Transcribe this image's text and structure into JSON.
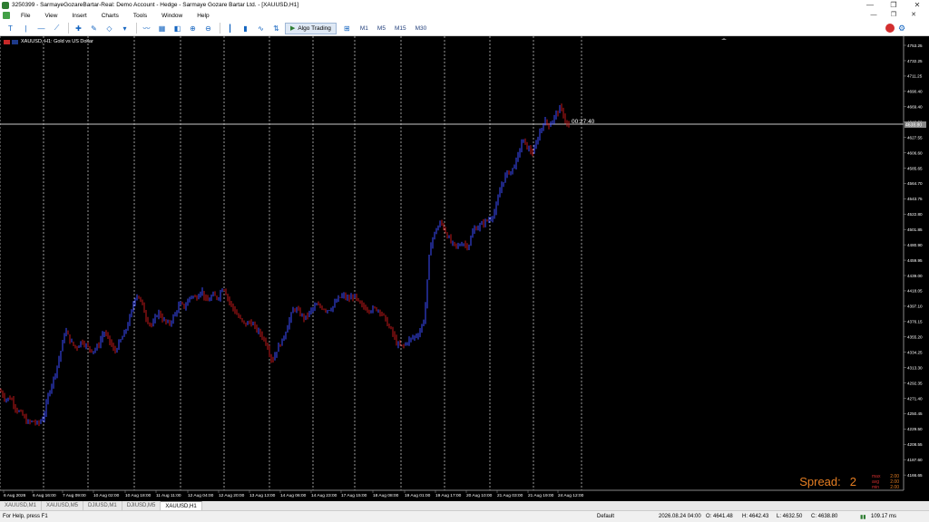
{
  "window": {
    "title": "3250399 - SarmayeGozareBartar-Real: Demo Account - Hedge - Sarmaye Gozare Bartar Ltd. - [XAUUSD,H1]",
    "minimize": "—",
    "maximize": "❐",
    "close": "✕"
  },
  "menu": {
    "items": [
      "File",
      "View",
      "Insert",
      "Charts",
      "Tools",
      "Window",
      "Help"
    ],
    "child_minimize": "—",
    "child_restore": "❐",
    "child_close": "✕"
  },
  "toolbar": {
    "algo_label": "Algo Trading",
    "timeframes": [
      "M1",
      "M5",
      "M15",
      "M30"
    ]
  },
  "chart": {
    "symbol_label": "XAUUSD, H1:  Gold vs US Dollar",
    "countdown": "00:27:40",
    "current_price_label": "4638.80",
    "spread_label": "Spread:",
    "spread_value": "2",
    "stats": [
      {
        "key": "max",
        "value": "2.00"
      },
      {
        "key": "avg",
        "value": "2.00"
      },
      {
        "key": "min",
        "value": "2.00"
      }
    ],
    "colors": {
      "background": "#000000",
      "bull": "#3d4dff",
      "bear": "#c0181a",
      "grid": "#ffffff",
      "axis_text": "#ffffff",
      "price_line": "#c8c8c8",
      "spread_text": "#e67e22"
    }
  },
  "chart_data": {
    "type": "candlestick",
    "title": "XAUUSD, H1: Gold vs US Dollar",
    "ylim": [
      4145.8,
      4765.6
    ],
    "y_ticks": [
      "4753.25",
      "4732.25",
      "4711.25",
      "4690.40",
      "4669.40",
      "4648.50",
      "4627.55",
      "4606.60",
      "4585.65",
      "4564.70",
      "4543.75",
      "4522.80",
      "4501.85",
      "4480.90",
      "4459.95",
      "4439.00",
      "4418.05",
      "4397.10",
      "4376.15",
      "4355.20",
      "4334.25",
      "4313.30",
      "4292.35",
      "4271.40",
      "4250.45",
      "4229.50",
      "4208.55",
      "4187.60",
      "4166.65"
    ],
    "x_ticks": [
      "6 Aug 2026",
      "6 Aug 16:00",
      "7 Aug 09:00",
      "10 Aug 02:00",
      "10 Aug 18:00",
      "11 Aug 11:00",
      "12 Aug 04:00",
      "12 Aug 20:00",
      "13 Aug 13:00",
      "14 Aug 06:00",
      "14 Aug 23:00",
      "17 Aug 15:00",
      "18 Aug 08:00",
      "19 Aug 01:00",
      "19 Aug 17:00",
      "20 Aug 10:00",
      "21 Aug 03:00",
      "21 Aug 19:00",
      "24 Aug 12:00"
    ],
    "close_path": [
      [
        0,
        4282
      ],
      [
        6,
        4270
      ],
      [
        12,
        4272
      ],
      [
        18,
        4256
      ],
      [
        24,
        4250
      ],
      [
        30,
        4238
      ],
      [
        36,
        4240
      ],
      [
        42,
        4236
      ],
      [
        48,
        4246
      ],
      [
        54,
        4280
      ],
      [
        60,
        4302
      ],
      [
        66,
        4330
      ],
      [
        72,
        4365
      ],
      [
        78,
        4348
      ],
      [
        84,
        4340
      ],
      [
        90,
        4350
      ],
      [
        96,
        4342
      ],
      [
        102,
        4336
      ],
      [
        108,
        4342
      ],
      [
        114,
        4362
      ],
      [
        120,
        4352
      ],
      [
        126,
        4334
      ],
      [
        132,
        4348
      ],
      [
        138,
        4362
      ],
      [
        144,
        4385
      ],
      [
        150,
        4415
      ],
      [
        156,
        4402
      ],
      [
        162,
        4378
      ],
      [
        168,
        4370
      ],
      [
        174,
        4390
      ],
      [
        180,
        4378
      ],
      [
        186,
        4372
      ],
      [
        192,
        4384
      ],
      [
        198,
        4400
      ],
      [
        204,
        4396
      ],
      [
        210,
        4412
      ],
      [
        216,
        4408
      ],
      [
        222,
        4420
      ],
      [
        228,
        4402
      ],
      [
        234,
        4412
      ],
      [
        240,
        4408
      ],
      [
        246,
        4425
      ],
      [
        252,
        4405
      ],
      [
        258,
        4392
      ],
      [
        264,
        4380
      ],
      [
        270,
        4372
      ],
      [
        276,
        4376
      ],
      [
        282,
        4366
      ],
      [
        288,
        4358
      ],
      [
        294,
        4345
      ],
      [
        300,
        4322
      ],
      [
        306,
        4340
      ],
      [
        312,
        4352
      ],
      [
        318,
        4375
      ],
      [
        324,
        4395
      ],
      [
        330,
        4388
      ],
      [
        336,
        4380
      ],
      [
        342,
        4390
      ],
      [
        348,
        4398
      ],
      [
        354,
        4396
      ],
      [
        360,
        4392
      ],
      [
        366,
        4395
      ],
      [
        372,
        4406
      ],
      [
        378,
        4412
      ],
      [
        384,
        4406
      ],
      [
        390,
        4412
      ],
      [
        396,
        4400
      ],
      [
        402,
        4395
      ],
      [
        408,
        4392
      ],
      [
        414,
        4394
      ],
      [
        420,
        4390
      ],
      [
        426,
        4375
      ],
      [
        432,
        4362
      ],
      [
        438,
        4344
      ],
      [
        444,
        4342
      ],
      [
        450,
        4350
      ],
      [
        456,
        4355
      ],
      [
        462,
        4360
      ],
      [
        468,
        4382
      ],
      [
        474,
        4480
      ],
      [
        480,
        4500
      ],
      [
        486,
        4512
      ],
      [
        492,
        4496
      ],
      [
        498,
        4482
      ],
      [
        504,
        4478
      ],
      [
        510,
        4484
      ],
      [
        516,
        4478
      ],
      [
        522,
        4502
      ],
      [
        528,
        4506
      ],
      [
        534,
        4512
      ],
      [
        540,
        4516
      ],
      [
        546,
        4528
      ],
      [
        552,
        4560
      ],
      [
        558,
        4578
      ],
      [
        564,
        4582
      ],
      [
        570,
        4598
      ],
      [
        576,
        4625
      ],
      [
        582,
        4612
      ],
      [
        588,
        4606
      ],
      [
        594,
        4632
      ],
      [
        600,
        4650
      ],
      [
        606,
        4644
      ],
      [
        612,
        4658
      ],
      [
        618,
        4668
      ],
      [
        624,
        4648
      ],
      [
        628,
        4638
      ]
    ],
    "current_price": 4638.8,
    "spread": 2
  }
}
